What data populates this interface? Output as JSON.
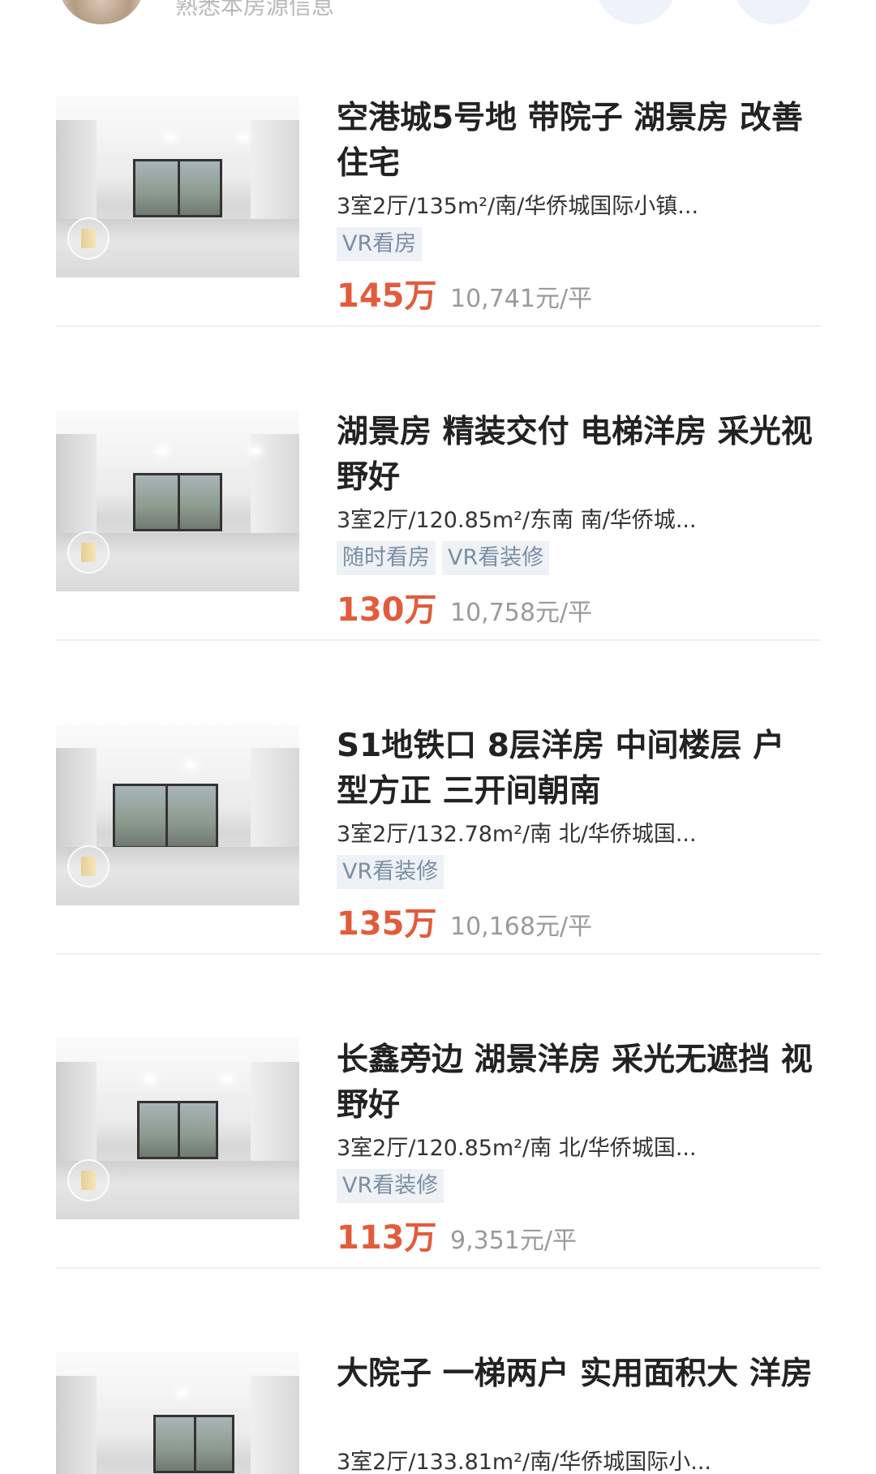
{
  "header": {
    "hint_text": "熟悉本房源信息"
  },
  "listings": [
    {
      "title": "空港城5号地 带院子 湖景房 改善住宅",
      "meta": "3室2厅/135m²/南/华侨城国际小镇...",
      "tags": [
        "VR看房"
      ],
      "price": "145万",
      "unit_price": "10,741元/平"
    },
    {
      "title": "湖景房 精装交付 电梯洋房 采光视野好",
      "meta": "3室2厅/120.85m²/东南 南/华侨城...",
      "tags": [
        "随时看房",
        "VR看装修"
      ],
      "price": "130万",
      "unit_price": "10,758元/平"
    },
    {
      "title": "S1地铁口 8层洋房 中间楼层 户型方正 三开间朝南",
      "meta": "3室2厅/132.78m²/南 北/华侨城国...",
      "tags": [
        "VR看装修"
      ],
      "price": "135万",
      "unit_price": "10,168元/平"
    },
    {
      "title": "长鑫旁边 湖景洋房 采光无遮挡 视野好",
      "meta": "3室2厅/120.85m²/南 北/华侨城国...",
      "tags": [
        "VR看装修"
      ],
      "price": "113万",
      "unit_price": "9,351元/平"
    },
    {
      "title": "大院子 一梯两户 实用面积大 洋房",
      "meta": "3室2厅/133.81m²/南/华侨城国际小...",
      "tags": [],
      "price": "",
      "unit_price": ""
    }
  ],
  "colors": {
    "price": "#e25c3c",
    "tag_bg": "#eef1f5",
    "tag_text": "#7b8ea5"
  }
}
